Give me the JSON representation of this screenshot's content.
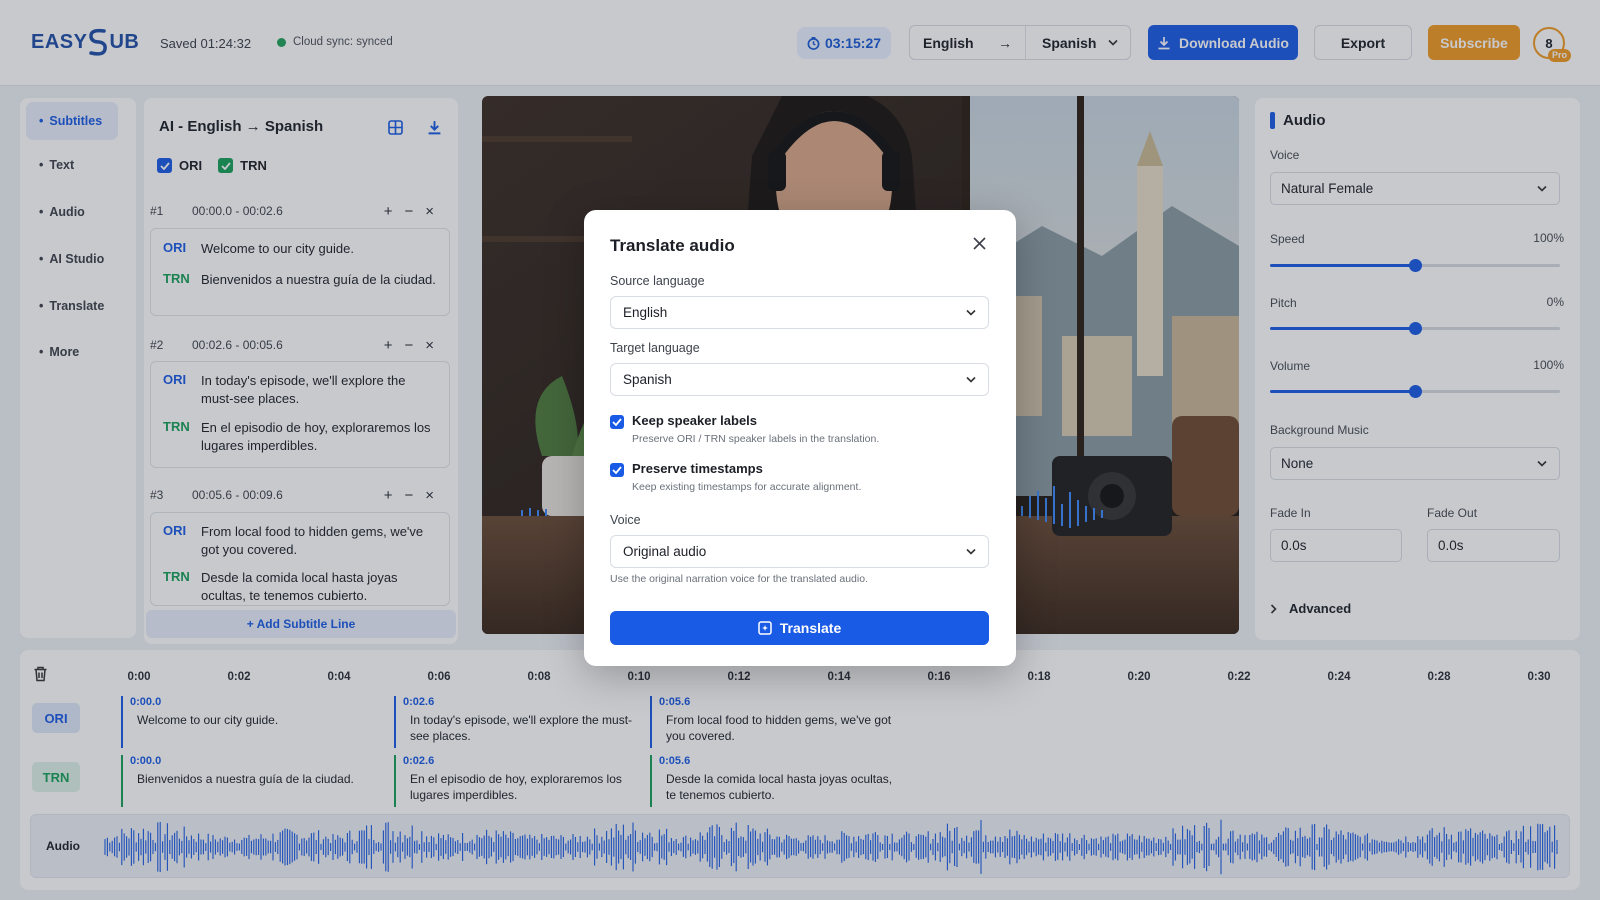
{
  "header": {
    "logo_text_left": "EASY",
    "logo_text_right": "UB",
    "saved": "Saved 01:24:32",
    "sync": "Cloud sync: synced",
    "timer": "03:15:27",
    "source_lang": "English",
    "target_lang": "Spanish",
    "arrow": "→",
    "download": "Download Audio",
    "export": "Export",
    "subscribe": "Subscribe",
    "avatar": "8",
    "badge": "Pro"
  },
  "sidebar": {
    "items": [
      {
        "label": "Subtitles",
        "active": true
      },
      {
        "label": "Text"
      },
      {
        "label": "Audio"
      },
      {
        "label": "AI Studio"
      },
      {
        "label": "Translate"
      },
      {
        "label": "More"
      }
    ]
  },
  "subtitles": {
    "title": "AI - English → Spanish",
    "ori_label": "ORI",
    "trn_label": "TRN",
    "add_line": "+ Add Subtitle Line",
    "entries": [
      {
        "num": "#1",
        "time": "00:00.0  -  00:02.6",
        "ori": "Welcome to our city guide.",
        "trn": "Bienvenidos a nuestra guía de la ciudad."
      },
      {
        "num": "#2",
        "time": "00:02.6  -  00:05.6",
        "ori": "In today's episode, we'll explore the must-see places.",
        "trn": "En el episodio de hoy, exploraremos los lugares imperdibles."
      },
      {
        "num": "#3",
        "time": "00:05.6  -  00:09.6",
        "ori": "From local food to hidden gems, we've got you covered.",
        "trn": "Desde la comida local hasta joyas ocultas, te tenemos cubierto."
      }
    ]
  },
  "audio_panel": {
    "title": "Audio",
    "voice_label": "Voice",
    "voice_value": "Natural Female",
    "speed_label": "Speed",
    "speed_value": "100%",
    "speed_level": 0.5,
    "pitch_label": "Pitch",
    "pitch_value": "0%",
    "pitch_level": 0.5,
    "volume_label": "Volume",
    "volume_value": "100%",
    "volume_level": 0.5,
    "bg_label": "Background Music",
    "bg_value": "None",
    "fade_in_label": "Fade In",
    "fade_in_value": "0.0s",
    "fade_out_label": "Fade Out",
    "fade_out_value": "0.0s",
    "advanced": "Advanced"
  },
  "timeline": {
    "ticks": [
      "0:00",
      "0:02",
      "0:04",
      "0:06",
      "0:08",
      "0:10",
      "0:12",
      "0:14",
      "0:16",
      "0:18",
      "0:20",
      "0:22",
      "0:24",
      "0:28",
      "0:30"
    ],
    "ori_label": "ORI",
    "trn_label": "TRN",
    "audio_label": "Audio",
    "ori_segments": [
      {
        "start": "0:00.0",
        "text": "Welcome to our city guide."
      },
      {
        "start": "0:02.6",
        "text": "In today's episode, we'll explore the must-see places."
      },
      {
        "start": "0:05.6",
        "text": "From local food to hidden gems, we've got you covered."
      }
    ],
    "trn_segments": [
      {
        "start": "0:00.0",
        "text": "Bienvenidos a nuestra guía de la ciudad."
      },
      {
        "start": "0:02.6",
        "text": "En el episodio de hoy, exploraremos los lugares imperdibles."
      },
      {
        "start": "0:05.6",
        "text": "Desde la comida local hasta joyas ocultas, te tenemos cubierto."
      }
    ]
  },
  "modal": {
    "title": "Translate audio",
    "source_label": "Source language",
    "source_value": "English",
    "target_label": "Target language",
    "target_value": "Spanish",
    "keep_labels_title": "Keep speaker labels",
    "keep_labels_desc": "Preserve ORI / TRN speaker labels in the translation.",
    "keep_labels_checked": true,
    "preserve_ts_title": "Preserve timestamps",
    "preserve_ts_desc": "Keep existing timestamps for accurate alignment.",
    "preserve_ts_checked": true,
    "voice_label": "Voice",
    "voice_value": "Original audio",
    "voice_hint": "Use the original narration voice for the translated audio.",
    "button": "Translate"
  },
  "colors": {
    "accent": "#1a5be6",
    "green": "#18a058",
    "orange": "#f19a22"
  }
}
